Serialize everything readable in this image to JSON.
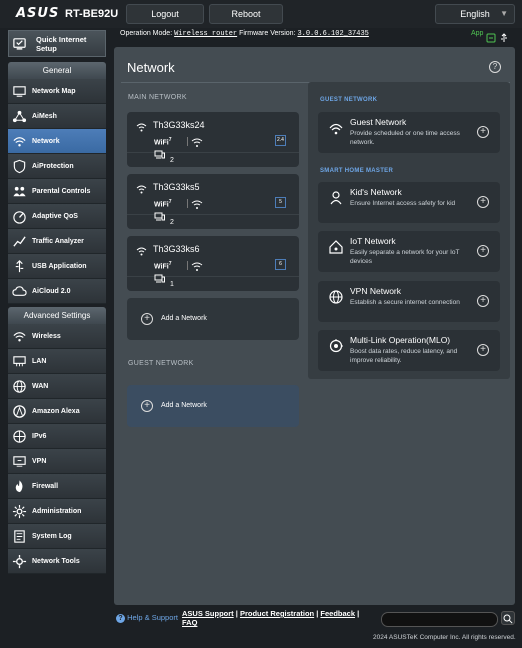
{
  "header": {
    "brand": "ASUS",
    "model": "RT-BE92U",
    "logout_label": "Logout",
    "reboot_label": "Reboot",
    "language": "English"
  },
  "status": {
    "mode_label": "Operation Mode:",
    "mode_value": "Wireless router",
    "fw_label": "Firmware Version:",
    "fw_value": "3.0.0.6.102_37435",
    "app_label": "App"
  },
  "sidebar": {
    "qis_label_1": "Quick Internet",
    "qis_label_2": "Setup",
    "general_title": "General",
    "general_items": [
      {
        "label": "Network Map",
        "icon": "network-map-icon"
      },
      {
        "label": "AiMesh",
        "icon": "aimesh-icon"
      },
      {
        "label": "Network",
        "icon": "network-icon"
      },
      {
        "label": "AiProtection",
        "icon": "shield-icon"
      },
      {
        "label": "Parental Controls",
        "icon": "family-icon"
      },
      {
        "label": "Adaptive QoS",
        "icon": "qos-icon"
      },
      {
        "label": "Traffic Analyzer",
        "icon": "chart-icon"
      },
      {
        "label": "USB Application",
        "icon": "usb-icon"
      },
      {
        "label": "AiCloud 2.0",
        "icon": "cloud-icon"
      }
    ],
    "advanced_title": "Advanced Settings",
    "advanced_items": [
      {
        "label": "Wireless",
        "icon": "wireless-icon"
      },
      {
        "label": "LAN",
        "icon": "lan-icon"
      },
      {
        "label": "WAN",
        "icon": "globe-icon"
      },
      {
        "label": "Amazon Alexa",
        "icon": "alexa-icon"
      },
      {
        "label": "IPv6",
        "icon": "ipv6-icon"
      },
      {
        "label": "VPN",
        "icon": "vpn-icon"
      },
      {
        "label": "Firewall",
        "icon": "firewall-icon"
      },
      {
        "label": "Administration",
        "icon": "admin-icon"
      },
      {
        "label": "System Log",
        "icon": "log-icon"
      },
      {
        "label": "Network Tools",
        "icon": "tools-icon"
      }
    ],
    "active_item": "Network"
  },
  "main": {
    "title": "Network",
    "main_network_label": "MAIN NETWORK",
    "networks": [
      {
        "name": "Th3G33ks24",
        "wifi": "WiFi",
        "band": "2.4",
        "devices": "2"
      },
      {
        "name": "Th3G33ks5",
        "wifi": "WiFi",
        "band": "5",
        "devices": "2"
      },
      {
        "name": "Th3G33ks6",
        "wifi": "WiFi",
        "band": "6",
        "devices": "1"
      }
    ],
    "add_network_label": "Add a Network",
    "guest_network_label": "GUEST NETWORK",
    "guest_add_label": "Add a Network"
  },
  "right": {
    "guest_title": "GUEST NETWORK",
    "guest_option": {
      "title": "Guest Network",
      "desc": "Provide scheduled or one time access network."
    },
    "shm_title": "SMART HOME MASTER",
    "options": [
      {
        "title": "Kid's Network",
        "desc": "Ensure Internet access safety for kid",
        "icon": "kid-icon"
      },
      {
        "title": "IoT Network",
        "desc": "Easily separate a network for your IoT devices",
        "icon": "iot-icon"
      },
      {
        "title": "VPN Network",
        "desc": "Establish a secure internet connection",
        "icon": "vpn-globe-icon"
      },
      {
        "title": "Multi-Link Operation(MLO)",
        "desc": "Boost data rates, reduce latency, and improve reliability.",
        "icon": "mlo-icon"
      }
    ]
  },
  "footer": {
    "help_label": "Help & Support",
    "link_support": "ASUS Support",
    "link_registration": "Product Registration",
    "link_feedback": "Feedback",
    "link_faq": "FAQ",
    "copyright": "2024 ASUSTeK Computer Inc. All rights reserved."
  },
  "colors": {
    "accent": "#4d7db8",
    "link": "#6ea6e6",
    "app_green": "#4fc352"
  }
}
